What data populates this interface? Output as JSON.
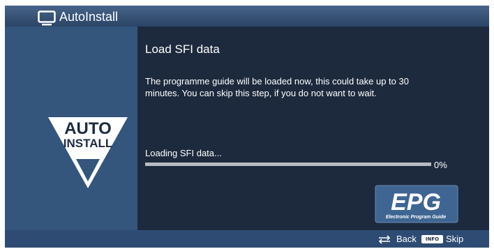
{
  "window": {
    "title": "AutoInstall",
    "icon": "tv-icon"
  },
  "logo": {
    "line1": "AUTO",
    "line2": "INSTALL"
  },
  "content": {
    "heading": "Load SFI data",
    "message": "The programme guide will be loaded now, this could take up to 30 minutes. You can skip this step, if you do not want to wait.",
    "status": "Loading SFI data...",
    "progress_value": 0,
    "progress_label": "0%"
  },
  "epg_logo": {
    "title": "EPG",
    "subtitle": "Electronic Program Guide"
  },
  "footer": {
    "back_label": "Back",
    "back_icon": "swap-arrows-icon",
    "info_key": "INFO",
    "skip_label": "Skip"
  },
  "colors": {
    "background": "#1d2a3e",
    "panel": "#34557c",
    "title_bar": "#3a5a82",
    "progress_track": "#b8bcc2",
    "epg_badge": "#3f6592"
  }
}
